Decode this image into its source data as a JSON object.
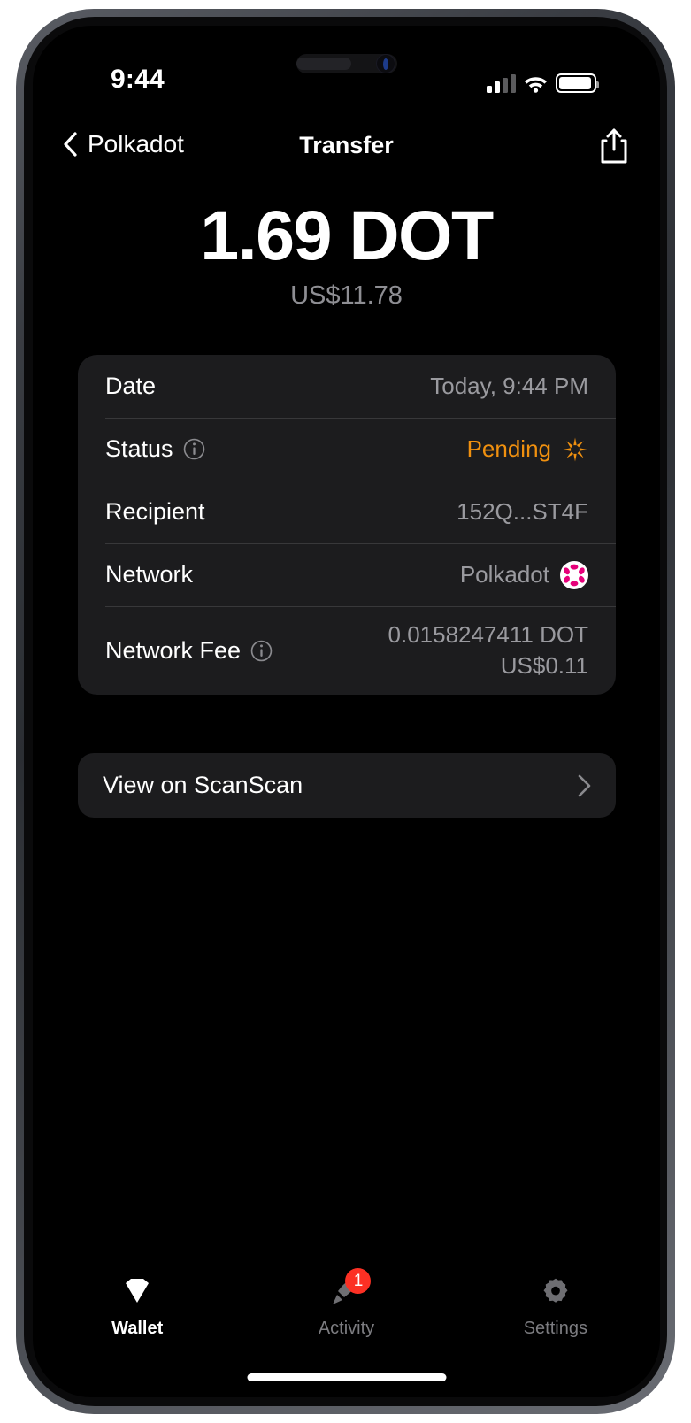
{
  "status_bar": {
    "time": "9:44",
    "signal_icon": "cellular-signal-icon",
    "wifi_icon": "wifi-icon",
    "battery_icon": "battery-icon"
  },
  "nav": {
    "back_label": "Polkadot",
    "back_icon": "chevron-left-icon",
    "title": "Transfer",
    "share_icon": "share-icon"
  },
  "hero": {
    "amount": "1.69 DOT",
    "fiat": "US$11.78"
  },
  "details": {
    "rows": [
      {
        "label": "Date",
        "value": "Today, 9:44 PM",
        "has_info": false,
        "trailing_icon": null
      },
      {
        "label": "Status",
        "value": "Pending",
        "has_info": true,
        "info_icon": "info-icon",
        "trailing_icon": "spinner-icon",
        "value_color": "#f0900f"
      },
      {
        "label": "Recipient",
        "value": "152Q...ST4F",
        "has_info": false,
        "trailing_icon": null
      },
      {
        "label": "Network",
        "value": "Polkadot",
        "has_info": false,
        "trailing_icon": "polkadot-logo-icon"
      }
    ],
    "fee_row": {
      "label": "Network Fee",
      "info_icon": "info-icon",
      "value_crypto": "0.0158247411 DOT",
      "value_fiat": "US$0.11"
    }
  },
  "explorer": {
    "label": "View on ScanScan",
    "chevron_icon": "chevron-right-icon"
  },
  "tabs": [
    {
      "label": "Wallet",
      "icon": "diamond-icon",
      "active": true,
      "badge": null
    },
    {
      "label": "Activity",
      "icon": "rocket-icon",
      "active": false,
      "badge": "1"
    },
    {
      "label": "Settings",
      "icon": "gear-icon",
      "active": false,
      "badge": null
    }
  ],
  "colors": {
    "accent_pending": "#f0900f",
    "badge_red": "#fc3024",
    "polkadot_pink": "#e6007a",
    "card_bg": "#1c1c1e",
    "screen_bg": "#000000"
  }
}
